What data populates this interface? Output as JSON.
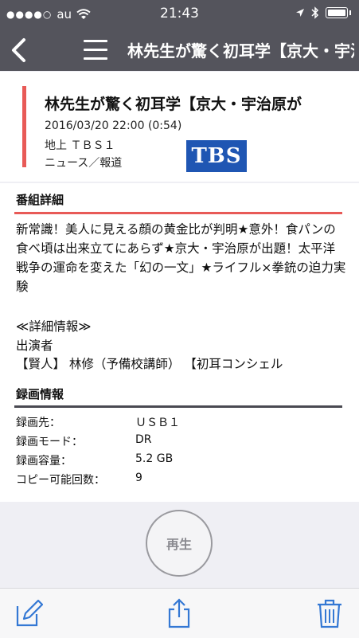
{
  "status": {
    "carrier": "au",
    "signal_dots": "●●●●○",
    "time": "21:43"
  },
  "nav": {
    "title": "林先生が驚く初耳学【京大・宇治原が"
  },
  "program": {
    "title": "林先生が驚く初耳学【京大・宇治原が",
    "datetime": "2016/03/20 22:00 (0:54)",
    "channel": "地上 ＴＢＳ１",
    "genre": "ニュース／報道",
    "logo_text": "TBS",
    "logo_color": "#1f56b3"
  },
  "details": {
    "heading": "番組詳細",
    "description": "新常識！美人に見える顔の黄金比が判明★意外！食パンの食べ頃は出来立てにあらず★京大・宇治原が出題！太平洋戦争の運命を変えた「幻の一文」★ライフル×拳銃の迫力実験",
    "detail_info_label": "≪詳細情報≫",
    "performers_label": "出演者",
    "performers": "【賢人】 林修（予備校講師） 【初耳コンシェル"
  },
  "recording": {
    "heading": "録画情報",
    "rows": [
      {
        "label": "録画先：",
        "value": "ＵＳＢ１"
      },
      {
        "label": "録画モード：",
        "value": "DR"
      },
      {
        "label": "録画容量：",
        "value": "5.2 GB"
      },
      {
        "label": "コピー可能回数：",
        "value": "9"
      }
    ]
  },
  "actions": {
    "play_label": "再生",
    "accent_color": "#3478d4"
  }
}
